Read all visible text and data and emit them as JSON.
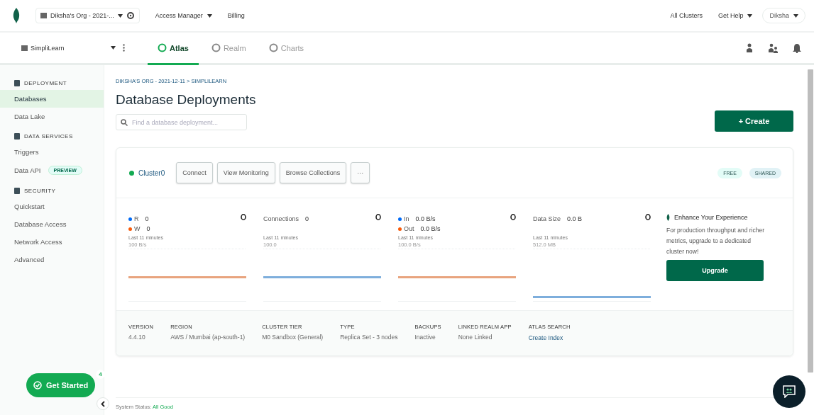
{
  "top_bar": {
    "org": "Diksha's Org - 2021-...",
    "links": [
      {
        "label": "Access Manager",
        "dropdown": true
      },
      {
        "label": "Billing",
        "dropdown": false
      }
    ],
    "right_links": [
      {
        "label": "All Clusters",
        "dropdown": false
      },
      {
        "label": "Get Help",
        "dropdown": true
      }
    ],
    "user": "Diksha"
  },
  "project_bar": {
    "project": "SimpliLearn",
    "tabs": [
      {
        "label": "Atlas",
        "selected": true
      },
      {
        "label": "Realm",
        "selected": false
      },
      {
        "label": "Charts",
        "selected": false
      }
    ]
  },
  "sidebar": {
    "sections": [
      {
        "title": "DEPLOYMENT",
        "items": [
          {
            "label": "Databases",
            "selected": true
          },
          {
            "label": "Data Lake",
            "selected": false
          }
        ]
      },
      {
        "title": "DATA SERVICES",
        "items": [
          {
            "label": "Triggers",
            "selected": false
          },
          {
            "label": "Data API",
            "selected": false,
            "badge": "PREVIEW"
          }
        ]
      },
      {
        "title": "SECURITY",
        "items": [
          {
            "label": "Quickstart",
            "selected": false
          },
          {
            "label": "Database Access",
            "selected": false
          },
          {
            "label": "Network Access",
            "selected": false
          },
          {
            "label": "Advanced",
            "selected": false
          }
        ]
      }
    ]
  },
  "breadcrumb": "DIKSHA'S ORG - 2021-12-11 > SIMPLILEARN",
  "title": "Database Deployments",
  "search": {
    "placeholder": "Find a database deployment..."
  },
  "create_button": "+ Create",
  "cluster": {
    "name": "Cluster0",
    "actions": [
      "Connect",
      "View Monitoring",
      "Browse Collections",
      "···"
    ],
    "tags": [
      {
        "label": "FREE",
        "color": "#e3fcf7"
      },
      {
        "label": "SHARED",
        "color": "#e1f2f6"
      }
    ],
    "metrics": [
      {
        "legend": [
          {
            "label": "R",
            "value": "0",
            "color": "#016bf8"
          },
          {
            "label": "W",
            "value": "0",
            "color": "#f95b0a"
          }
        ],
        "period": "Last 11 minutes",
        "axis": "100 B/s",
        "color": "#e8a47e"
      },
      {
        "legend": [
          {
            "label": "Connections",
            "value": "0"
          }
        ],
        "period": "Last 11 minutes",
        "axis": "100.0",
        "color": "#7eaedc"
      },
      {
        "legend": [
          {
            "label": "In",
            "value": "0.0 B/s",
            "color": "#016bf8"
          },
          {
            "label": "Out",
            "value": "0.0 B/s",
            "color": "#f95b0a"
          }
        ],
        "period": "Last 11 minutes",
        "axis": "100.0 B/s",
        "color": "#e8a47e"
      },
      {
        "legend": [
          {
            "label": "Data Size",
            "value": "0.0 B"
          }
        ],
        "period": "Last 11 minutes",
        "axis": "512.0 MB",
        "color": "#7eaedc"
      }
    ],
    "upsell": {
      "title": "Enhance Your Experience",
      "text": "For production throughput and richer metrics, upgrade to a dedicated cluster now!",
      "button": "Upgrade"
    },
    "details": [
      {
        "label": "VERSION",
        "value": "4.4.10"
      },
      {
        "label": "REGION",
        "value": "AWS / Mumbai (ap-south-1)"
      },
      {
        "label": "CLUSTER TIER",
        "value": "M0 Sandbox (General)"
      },
      {
        "label": "TYPE",
        "value": "Replica Set - 3 nodes"
      },
      {
        "label": "BACKUPS",
        "value": "Inactive"
      },
      {
        "label": "LINKED REALM APP",
        "value": "None Linked"
      },
      {
        "label": "ATLAS SEARCH",
        "value": "Create Index",
        "kind": "link"
      }
    ]
  },
  "get_started": {
    "label": "Get Started",
    "count": "4"
  },
  "status": {
    "label": "System Status:",
    "value": "All Good"
  }
}
